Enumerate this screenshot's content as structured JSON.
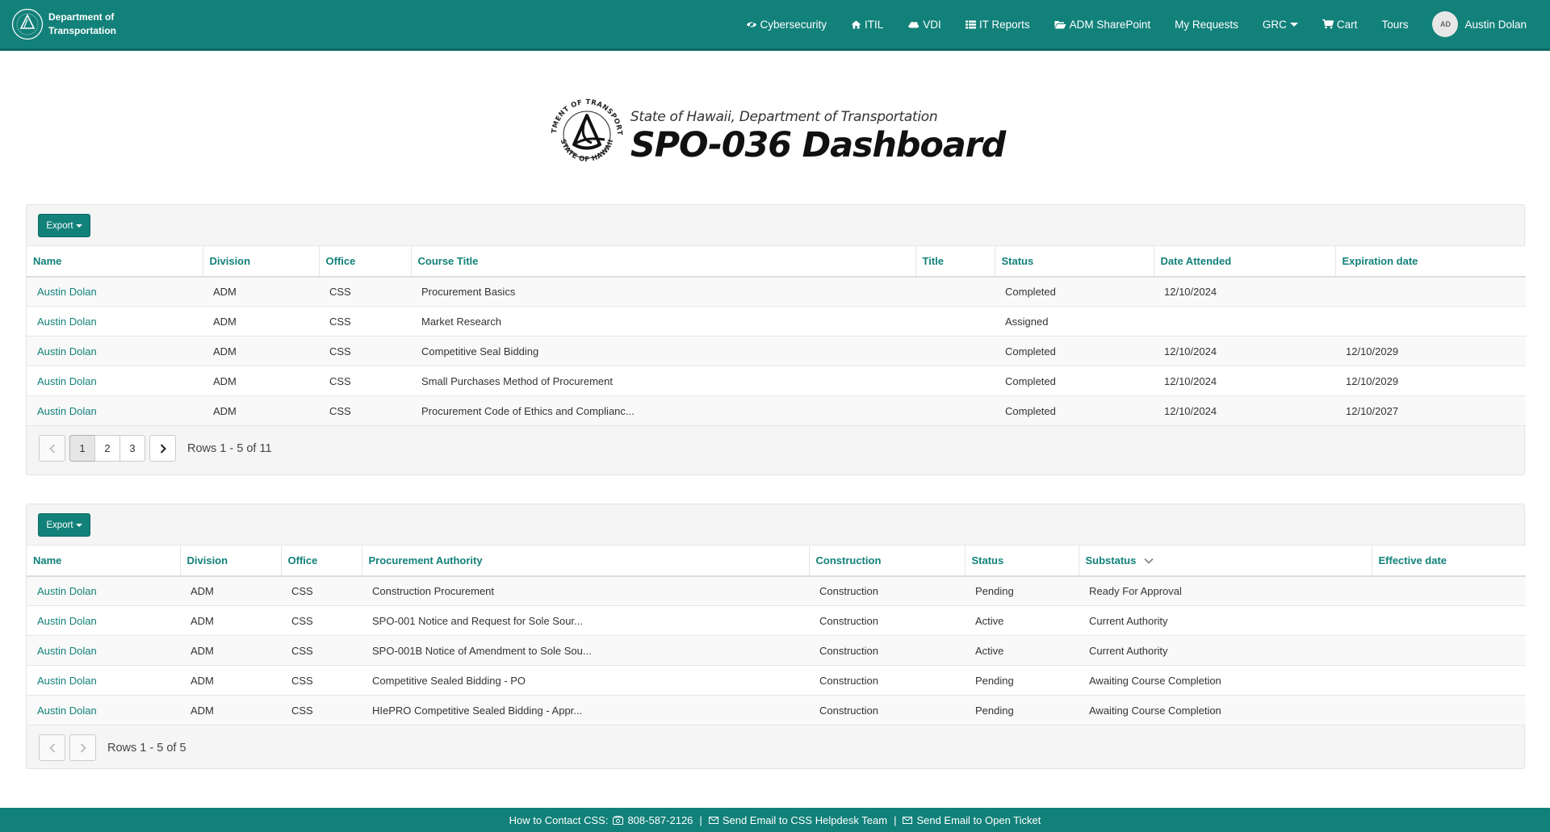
{
  "brand": {
    "line1": "Department of",
    "line2": "Transportation"
  },
  "nav": {
    "items": [
      {
        "label": "Cybersecurity",
        "icon": "eye-slash-icon"
      },
      {
        "label": "ITIL",
        "icon": "home-icon"
      },
      {
        "label": "VDI",
        "icon": "cloud-icon"
      },
      {
        "label": "IT Reports",
        "icon": "list-icon"
      },
      {
        "label": "ADM SharePoint",
        "icon": "folder-open-icon"
      },
      {
        "label": "My Requests"
      },
      {
        "label": "GRC"
      },
      {
        "label": "Cart",
        "icon": "cart-icon"
      },
      {
        "label": "Tours"
      }
    ],
    "user": {
      "initials": "AD",
      "name": "Austin Dolan"
    }
  },
  "header": {
    "subtitle": "State of Hawaii, Department of Transportation",
    "title": "SPO-036 Dashboard",
    "seal_text_top": "DEPARTMENT OF TRANSPORTATION",
    "seal_text_bottom": "STATE OF HAWAII"
  },
  "training": {
    "export_label": "Export",
    "columns": [
      "Name",
      "Division",
      "Office",
      "Course Title",
      "Title",
      "Status",
      "Date Attended",
      "Expiration date"
    ],
    "rows": [
      [
        "Austin Dolan",
        "ADM",
        "CSS",
        "Procurement Basics",
        "",
        "Completed",
        "12/10/2024",
        ""
      ],
      [
        "Austin Dolan",
        "ADM",
        "CSS",
        "Market Research",
        "",
        "Assigned",
        "",
        ""
      ],
      [
        "Austin Dolan",
        "ADM",
        "CSS",
        "Competitive Seal Bidding",
        "",
        "Completed",
        "12/10/2024",
        "12/10/2029"
      ],
      [
        "Austin Dolan",
        "ADM",
        "CSS",
        "Small Purchases Method of Procurement",
        "",
        "Completed",
        "12/10/2024",
        "12/10/2029"
      ],
      [
        "Austin Dolan",
        "ADM",
        "CSS",
        "Procurement Code of Ethics and Complianc...",
        "",
        "Completed",
        "12/10/2024",
        "12/10/2027"
      ]
    ],
    "pages": [
      "1",
      "2",
      "3"
    ],
    "rows_info": "Rows 1 - 5 of 11"
  },
  "authority": {
    "export_label": "Export",
    "columns": [
      "Name",
      "Division",
      "Office",
      "Procurement Authority",
      "Construction",
      "Status",
      "Substatus",
      "Effective date"
    ],
    "rows": [
      [
        "Austin Dolan",
        "ADM",
        "CSS",
        "Construction Procurement",
        "Construction",
        "Pending",
        "Ready For Approval",
        ""
      ],
      [
        "Austin Dolan",
        "ADM",
        "CSS",
        "SPO-001 Notice and Request for Sole Sour...",
        "Construction",
        "Active",
        "Current Authority",
        ""
      ],
      [
        "Austin Dolan",
        "ADM",
        "CSS",
        "SPO-001B Notice of Amendment to Sole Sou...",
        "Construction",
        "Active",
        "Current Authority",
        ""
      ],
      [
        "Austin Dolan",
        "ADM",
        "CSS",
        "Competitive Sealed Bidding - PO",
        "Construction",
        "Pending",
        "Awaiting Course Completion",
        ""
      ],
      [
        "Austin Dolan",
        "ADM",
        "CSS",
        "HIePRO Competitive Sealed Bidding - Appr...",
        "Construction",
        "Pending",
        "Awaiting Course Completion",
        ""
      ]
    ],
    "rows_info": "Rows 1 - 5 of 5"
  },
  "footer": {
    "contact_label": "How to Contact CSS:",
    "phone": "808-587-2126",
    "email_helpdesk": "Send Email to CSS Helpdesk Team",
    "email_ticket": "Send Email to Open Ticket",
    "separator": "|"
  },
  "colors": {
    "primary": "#12817a",
    "panel_bg": "#f5f5f5"
  }
}
